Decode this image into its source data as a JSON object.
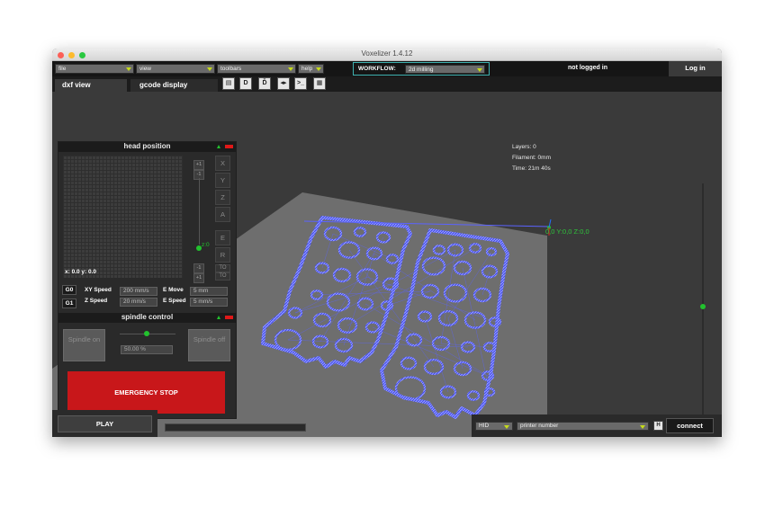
{
  "window": {
    "title": "Voxelizer 1.4.12"
  },
  "menubar": {
    "file": "file",
    "view": "view",
    "toolbars": "toolbars",
    "help": "help",
    "workflow_label": "WORKFLOW:",
    "workflow_value": "2d milling",
    "login_status": "not logged in",
    "login_button": "Log in"
  },
  "tabs": {
    "dxf": "dxf view",
    "gcode": "gcode display"
  },
  "toolbar": {
    "icons": [
      "save-icon",
      "d-icon",
      "d-outline-icon",
      "toggle-icon",
      "terminal-icon",
      "grid-icon"
    ],
    "terminal_glyph": ">_"
  },
  "hud": {
    "layers": "Layers: 0",
    "filament": "Filament: 0mm",
    "time": "Time: 21m 40s"
  },
  "coords": "0,0 Y:0,0 Z:0,0",
  "head_position": {
    "title": "head position",
    "readout": "x: 0.0 y: 0.0",
    "axes": [
      "X",
      "Y",
      "Z",
      "A",
      "E",
      "R"
    ],
    "z_label": "z:0",
    "step_up": "+1",
    "step_down": "-1",
    "to_label": "TO"
  },
  "motion": {
    "g0": "G0",
    "g1": "G1",
    "xy_speed_label": "XY Speed",
    "xy_speed_value": "200 mm/s",
    "z_speed_label": "Z Speed",
    "z_speed_value": "20 mm/s",
    "e_move_label": "E Move",
    "e_move_value": "5 mm",
    "e_speed_label": "E Speed",
    "e_speed_value": "5 mm/s"
  },
  "spindle": {
    "title": "spindle control",
    "on": "Spindle on",
    "off": "Spindle off",
    "percent": "50.00 %",
    "level": 0.5
  },
  "emergency": "EMERGENCY STOP",
  "play": "PLAY",
  "connection": {
    "mode": "HID",
    "printer": "printer number",
    "connect": "connect",
    "save_glyph": "H"
  },
  "colors": {
    "toolpath": "#5b63ff",
    "accent_green": "#22c22e",
    "estop_red": "#c8171a",
    "workflow_border": "#3fb2b0",
    "dropdown_arrow": "#c6dc1a"
  }
}
